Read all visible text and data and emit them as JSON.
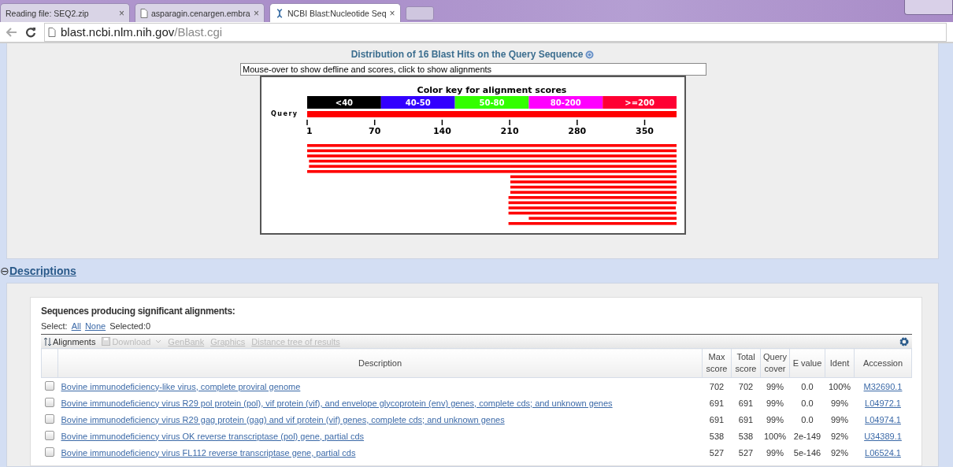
{
  "browser": {
    "tabs": [
      {
        "title": "Reading file: SEQ2.zip",
        "close": "×",
        "selected": false,
        "kind": "plain"
      },
      {
        "title": "asparagin.cenargen.embra",
        "close": "×",
        "selected": false,
        "kind": "page"
      },
      {
        "title": "NCBI Blast:Nucleotide Seq",
        "close": "×",
        "selected": true,
        "kind": "dna"
      }
    ],
    "address": {
      "host": "blast.ncbi.nlm.nih.gov",
      "path": "/Blast.cgi"
    }
  },
  "graphic": {
    "title": "Distribution of 16 Blast Hits on the Query Sequence",
    "hint": "Mouse-over to show defline and scores, click to show alignments",
    "key_title": "Color key for alignment scores",
    "key": [
      {
        "label": "<40",
        "color": "#000000"
      },
      {
        "label": "40-50",
        "color": "#3300ff"
      },
      {
        "label": "50-80",
        "color": "#33ff00"
      },
      {
        "label": "80-200",
        "color": "#ff00ff"
      },
      {
        "label": ">=200",
        "color": "#ff0033"
      }
    ],
    "query_label": "Query",
    "ticks": [
      "1",
      "70",
      "140",
      "210",
      "280",
      "350"
    ]
  },
  "descriptions": {
    "toggle": "⊖",
    "title": "Descriptions",
    "heading": "Sequences producing significant alignments:",
    "select_label": "Select:",
    "select_all": "All",
    "select_none": "None",
    "selected_count": "Selected:0",
    "toolbar": [
      {
        "label": "Alignments",
        "disabled": false,
        "kind": "sort"
      },
      {
        "label": "Download",
        "disabled": true,
        "kind": "download"
      },
      {
        "label": "GenBank",
        "disabled": true,
        "kind": "link"
      },
      {
        "label": "Graphics",
        "disabled": true,
        "kind": "link"
      },
      {
        "label": "Distance tree of results",
        "disabled": true,
        "kind": "link"
      }
    ],
    "columns": [
      "Description",
      "Max score",
      "Total score",
      "Query cover",
      "E value",
      "Ident",
      "Accession"
    ],
    "rows": [
      {
        "checked": false,
        "cells": [
          "Bovine immunodeficiency-like virus, complete proviral genome",
          "702",
          "702",
          "99%",
          "0.0",
          "100%",
          "M32690.1"
        ]
      },
      {
        "checked": false,
        "cells": [
          "Bovine immunodeficiency virus R29 pol protein (pol), vif protein (vif), and envelope glycoprotein (env) genes, complete cds; and unknown genes",
          "691",
          "691",
          "99%",
          "0.0",
          "99%",
          "L04972.1"
        ]
      },
      {
        "checked": false,
        "cells": [
          "Bovine immunodeficiency virus R29 gag protein (gag) and vif protein (vif) genes, complete cds; and unknown genes",
          "691",
          "691",
          "99%",
          "0.0",
          "99%",
          "L04974.1"
        ]
      },
      {
        "checked": false,
        "cells": [
          "Bovine immunodeficiency virus OK reverse transcriptase (pol) gene, partial cds",
          "538",
          "538",
          "100%",
          "2e-149",
          "92%",
          "U34389.1"
        ]
      },
      {
        "checked": false,
        "cells": [
          "Bovine immunodeficiency virus FL112 reverse transcriptase gene, partial cds",
          "527",
          "527",
          "99%",
          "5e-146",
          "92%",
          "L06524.1"
        ]
      }
    ]
  }
}
